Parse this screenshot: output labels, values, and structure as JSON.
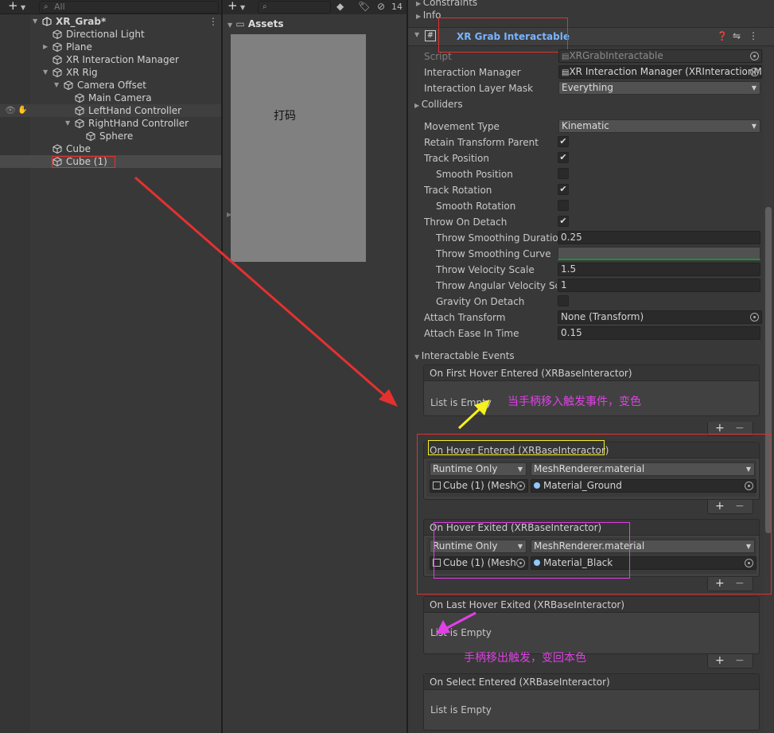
{
  "hierarchy": {
    "search_placeholder": "All",
    "scene": "XR_Grab*",
    "items": [
      {
        "label": "Directional Light"
      },
      {
        "label": "Plane"
      },
      {
        "label": "XR Interaction Manager"
      },
      {
        "label": "XR Rig"
      },
      {
        "label": "Camera Offset"
      },
      {
        "label": "Main Camera"
      },
      {
        "label": "LeftHand Controller"
      },
      {
        "label": "RightHand Controller"
      },
      {
        "label": "Sphere"
      },
      {
        "label": "Cube"
      },
      {
        "label": "Cube (1)"
      }
    ]
  },
  "project": {
    "assets_label": "Assets",
    "hidden_count": "14",
    "overlay_text": "打码"
  },
  "inspector": {
    "top_items": [
      "Constraints",
      "Info"
    ],
    "component_title": "XR Grab Interactable",
    "fields": {
      "script_label": "Script",
      "script_value": "XRGrabInteractable",
      "manager_label": "Interaction Manager",
      "manager_value": "XR Interaction Manager (XRInteractionM",
      "layer_label": "Interaction Layer Mask",
      "layer_value": "Everything",
      "colliders_label": "Colliders",
      "movement_label": "Movement Type",
      "movement_value": "Kinematic",
      "retain_label": "Retain Transform Parent",
      "track_pos_label": "Track Position",
      "smooth_pos_label": "Smooth Position",
      "track_rot_label": "Track Rotation",
      "smooth_rot_label": "Smooth Rotation",
      "throw_label": "Throw On Detach",
      "throw_dur_label": "Throw Smoothing Duration",
      "throw_dur_value": "0.25",
      "throw_curve_label": "Throw Smoothing Curve",
      "throw_vel_label": "Throw Velocity Scale",
      "throw_vel_value": "1.5",
      "throw_ang_label": "Throw Angular Velocity Sca",
      "throw_ang_value": "1",
      "gravity_label": "Gravity On Detach",
      "attach_label": "Attach Transform",
      "attach_value": "None (Transform)",
      "ease_label": "Attach Ease In Time",
      "ease_value": "0.15"
    },
    "checks": {
      "retain": true,
      "track_pos": true,
      "smooth_pos": false,
      "track_rot": true,
      "smooth_rot": false,
      "throw": true,
      "gravity": false
    },
    "events_label": "Interactable Events",
    "events": [
      {
        "name": "On First Hover Entered (XRBaseInteractor)",
        "empty": "List is Empty"
      },
      {
        "name": "On Hover Entered (XRBaseInteractor)",
        "mode": "Runtime Only",
        "func": "MeshRenderer.material",
        "target": "Cube (1) (Mesh",
        "arg": "Material_Ground"
      },
      {
        "name": "On Hover Exited (XRBaseInteractor)",
        "mode": "Runtime Only",
        "func": "MeshRenderer.material",
        "target": "Cube (1) (Mesh",
        "arg": "Material_Black"
      },
      {
        "name": "On Last Hover Exited (XRBaseInteractor)",
        "empty": "List is Empty"
      },
      {
        "name": "On Select Entered (XRBaseInteractor)",
        "empty": "List is Empty"
      }
    ],
    "plus": "+",
    "minus": "−"
  },
  "annotations": {
    "hover_enter_note": "当手柄移入触发事件，变色",
    "hover_exit_note": "手柄移出触发，变回本色",
    "arrow_red": "#e53030",
    "arrow_yellow": "#f5f020",
    "arrow_magenta": "#e040e6"
  }
}
